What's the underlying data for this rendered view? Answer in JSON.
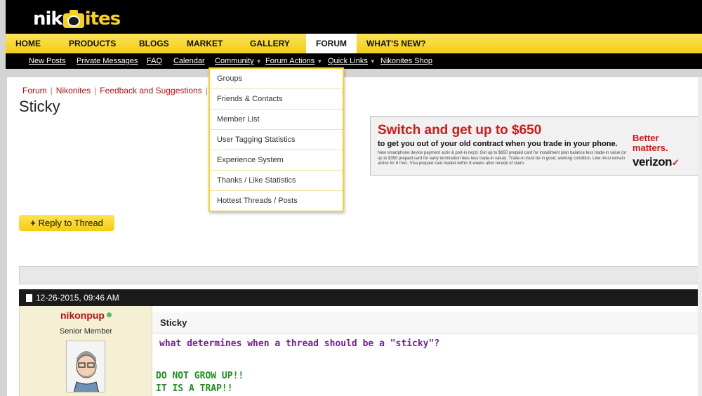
{
  "logo": {
    "part1": "nik",
    "part2": "ites"
  },
  "main_nav": [
    {
      "label": "HOME",
      "active": false
    },
    {
      "label": "PRODUCTS",
      "active": false
    },
    {
      "label": "BLOGS",
      "active": false
    },
    {
      "label": "MARKET",
      "active": false
    },
    {
      "label": "GALLERY",
      "active": false
    },
    {
      "label": "FORUM",
      "active": true
    },
    {
      "label": "WHAT'S NEW?",
      "active": false
    }
  ],
  "sub_nav": [
    {
      "label": "New Posts"
    },
    {
      "label": "Private Messages"
    },
    {
      "label": "FAQ"
    },
    {
      "label": "Calendar"
    },
    {
      "label": "Community",
      "has_menu": true
    },
    {
      "label": "Forum Actions",
      "has_menu": true
    },
    {
      "label": "Quick Links",
      "has_menu": true
    },
    {
      "label": "Nikonites Shop"
    }
  ],
  "community_menu": [
    "Groups",
    "Friends & Contacts",
    "Member List",
    "User Tagging Statistics",
    "Experience System",
    "Thanks / Like Statistics",
    "Hottest Threads / Posts"
  ],
  "breadcrumb": [
    "Forum",
    "Nikonites",
    "Feedback and Suggestions"
  ],
  "page_title": "Sticky",
  "ad": {
    "headline": "Switch and get up to $650",
    "subhead": "to get you out of your old contract when you trade in your phone.",
    "fineprint": "New smartphone device payment activ & port-in req'd. Get up to $650 prepaid card for installment plan balance less trade-in value (or up to $350 prepaid card for early termination fees less trade-in value). Trade-in must be in good, working condition. Line must remain active for 6 mos. Visa prepaid card mailed within 8 weeks after receipt of claim.",
    "tagline": "Better matters.",
    "brand": "verizon",
    "brand_mark": "✓"
  },
  "reply_button": {
    "icon": "+",
    "label": "Reply to Thread"
  },
  "post": {
    "date": "12-26-2015,",
    "time": "09:46 AM",
    "username": "nikonpup",
    "user_title": "Senior Member",
    "title": "Sticky",
    "message": "what determines when a thread should be a \"sticky\"?",
    "signature_1": "DO NOT GROW UP!!",
    "signature_2": "IT IS A TRAP!!"
  },
  "colors": {
    "accent_yellow": "#f6d21d",
    "link_red": "#b11212",
    "header_black": "#000000",
    "message_purple": "#7a1b9a",
    "signature_green": "#1f8f1f"
  }
}
